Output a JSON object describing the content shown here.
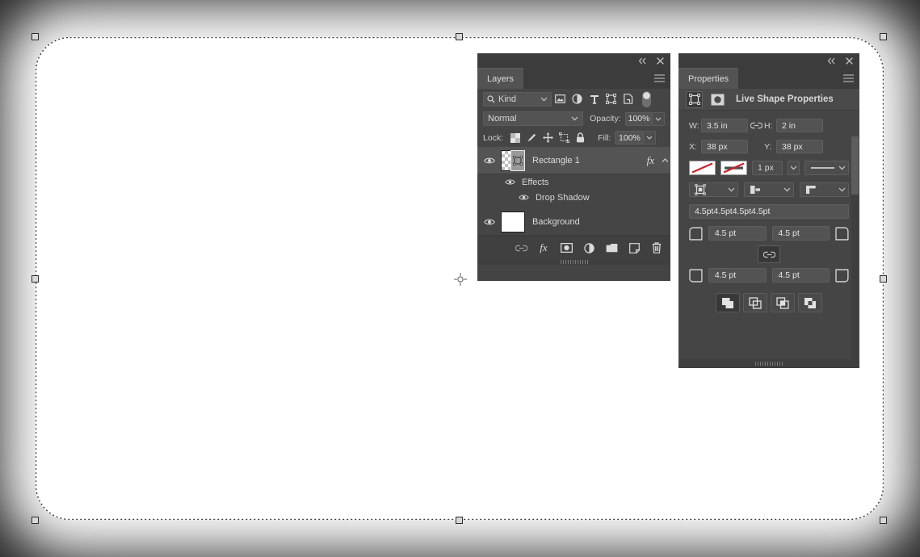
{
  "app": {
    "background_color": "#1e1e1e",
    "panel_bg": "#454545",
    "accent_text": "#dcdcdc"
  },
  "canvas": {
    "shape_name": "rounded-rectangle",
    "fill_color": "#ffffff",
    "reference_point": "center-crosshair",
    "handles": 8
  },
  "layers_panel": {
    "topbar": {
      "collapse_icon": "collapse-double-arrow-icon",
      "close_icon": "close-icon"
    },
    "tab_label": "Layers",
    "menu_icon": "panel-menu-icon",
    "filter": {
      "search_icon": "search-icon",
      "kind_label": "Kind",
      "chevron": "chevron-down-icon",
      "icons": [
        "pixel-filter-icon",
        "adjustment-filter-icon",
        "type-filter-icon",
        "shape-filter-icon",
        "smart-object-filter-icon"
      ],
      "toggle": "filter-toggle-switch"
    },
    "blend": {
      "mode": "Normal",
      "opacity_label": "Opacity:",
      "opacity_value": "100%"
    },
    "lock": {
      "label": "Lock:",
      "icons": [
        "lock-transparent-pixels-icon",
        "lock-image-pixels-icon",
        "lock-position-icon",
        "lock-artboard-nesting-icon",
        "lock-all-icon"
      ],
      "fill_label": "Fill:",
      "fill_value": "100%"
    },
    "layers": [
      {
        "name": "Rectangle 1",
        "visible": true,
        "selected": true,
        "thumbnail": "transparent-checker-vector-thumbnail",
        "has_effects": true,
        "fx_label": "fx",
        "expanded": true,
        "children": [
          {
            "name": "Effects",
            "visible": true,
            "indent": 1
          },
          {
            "name": "Drop Shadow",
            "visible": true,
            "indent": 2
          }
        ]
      },
      {
        "name": "Background",
        "visible": true,
        "selected": false,
        "thumbnail": "white-thumbnail",
        "has_effects": false,
        "children": []
      }
    ],
    "toolbar_icons": [
      "link-layers-icon",
      "add-layer-style-icon",
      "add-layer-mask-icon",
      "new-fill-adjustment-icon",
      "new-group-icon",
      "new-layer-icon",
      "delete-layer-icon"
    ]
  },
  "properties_panel": {
    "topbar": {
      "collapse_icon": "collapse-double-arrow-icon",
      "close_icon": "close-icon"
    },
    "tab_label": "Properties",
    "menu_icon": "panel-menu-icon",
    "header": {
      "shape_icon": "live-shape-icon",
      "mask_icon": "mask-thumbnail-icon",
      "title": "Live Shape Properties"
    },
    "dimensions": {
      "w_label": "W:",
      "w_value": "3.5 in",
      "link_icon": "link-wh-icon",
      "h_label": "H:",
      "h_value": "2 in",
      "x_label": "X:",
      "x_value": "38 px",
      "y_label": "Y:",
      "y_value": "38 px"
    },
    "stroke": {
      "fill_swatch": "no-fill-swatch",
      "stroke_swatch": "no-stroke-swatch",
      "width_value": "1 px",
      "width_chevron": "chevron-down-icon",
      "type_preview": "solid-line-preview",
      "type_chevron": "chevron-down-icon",
      "align_icon": "stroke-align-icon",
      "cap_icon": "stroke-cap-icon",
      "corner_icon": "stroke-corner-icon"
    },
    "dash_pattern": "4.5pt4.5pt4.5pt4.5pt",
    "corner_radius": {
      "top_left_icon": "corner-top-left-icon",
      "top_left": "4.5 pt",
      "top_right": "4.5 pt",
      "top_right_icon": "corner-top-right-icon",
      "link_icon": "link-radius-icon",
      "bottom_left_icon": "corner-bottom-left-icon",
      "bottom_left": "4.5 pt",
      "bottom_right": "4.5 pt",
      "bottom_right_icon": "corner-bottom-right-icon"
    },
    "path_operations": [
      "new-layer-op-icon",
      "combine-shapes-icon",
      "intersect-shapes-icon",
      "exclude-shapes-icon"
    ]
  }
}
